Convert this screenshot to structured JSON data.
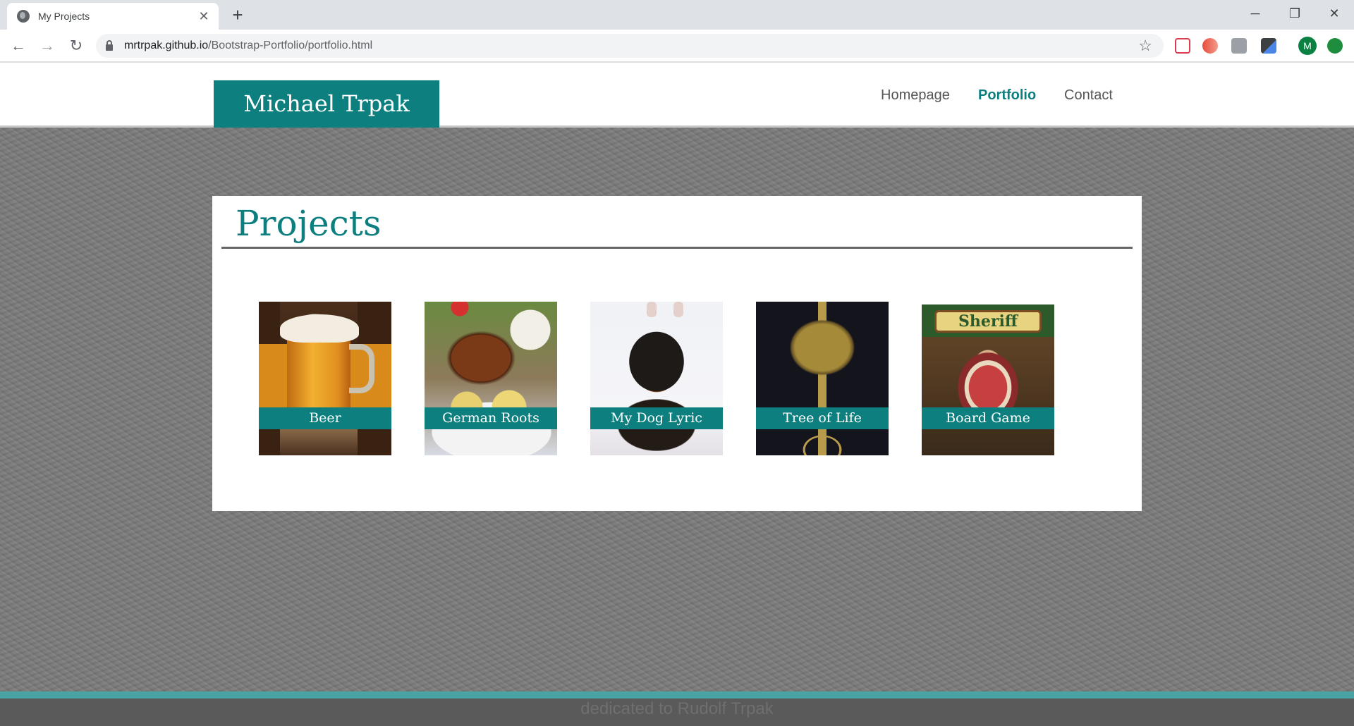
{
  "browser": {
    "tab_title": "My Projects",
    "tab_close": "✕",
    "new_tab": "+",
    "url_host": "mrtrpak.github.io",
    "url_path": "/Bootstrap-Portfolio/portfolio.html",
    "window_controls": {
      "minimize": "─",
      "restore": "❐",
      "close": "✕"
    },
    "nav": {
      "back": "←",
      "forward": "→",
      "reload": "↻"
    },
    "bookmark_star": "☆",
    "profile_initial": "M"
  },
  "site": {
    "brand": "Michael Trpak",
    "nav": [
      {
        "label": "Homepage",
        "active": false
      },
      {
        "label": "Portfolio",
        "active": true
      },
      {
        "label": "Contact",
        "active": false
      }
    ]
  },
  "projects": {
    "heading": "Projects",
    "items": [
      {
        "caption": "Beer",
        "icon": "beer-mug-image"
      },
      {
        "caption": "German Roots",
        "icon": "german-food-image"
      },
      {
        "caption": "My Dog Lyric",
        "icon": "dog-image"
      },
      {
        "caption": "Tree of Life",
        "icon": "tree-of-life-image"
      },
      {
        "caption": "Board Game",
        "icon": "sheriff-board-game-image",
        "logo_text": "Sheriff"
      }
    ]
  },
  "footer": {
    "text": "dedicated to Rudolf Trpak"
  },
  "colors": {
    "accent": "#0e7f7f",
    "footer_stripe": "#4aa3a3"
  }
}
